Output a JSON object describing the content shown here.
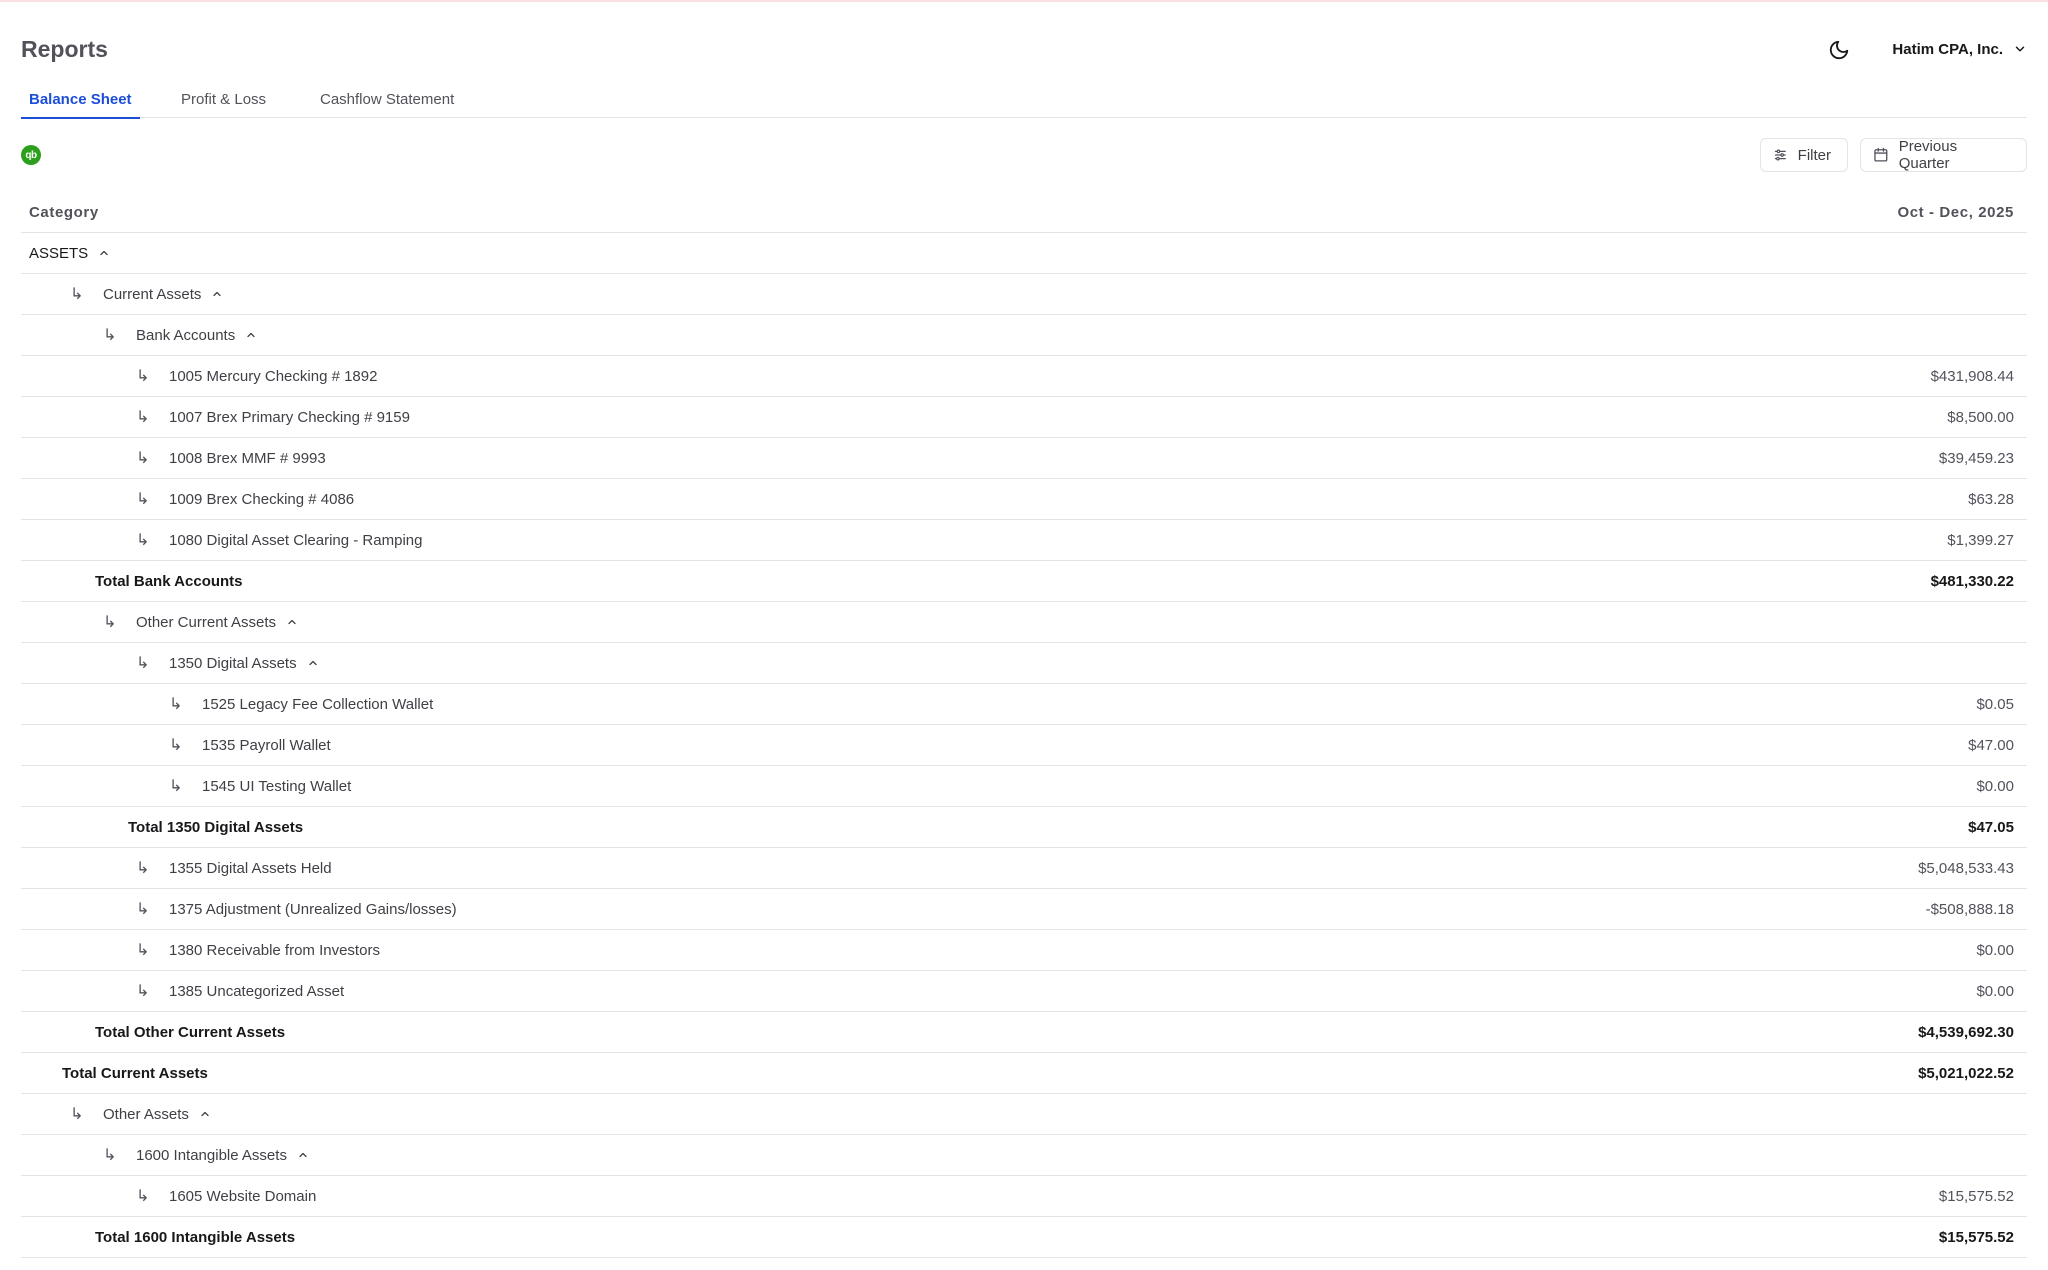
{
  "header": {
    "title": "Reports",
    "company": "Hatim CPA, Inc."
  },
  "tabs": [
    {
      "label": "Balance Sheet",
      "active": true
    },
    {
      "label": "Profit & Loss",
      "active": false
    },
    {
      "label": "Cashflow Statement",
      "active": false
    }
  ],
  "toolbar": {
    "logo_text": "qb",
    "filter_label": "Filter",
    "period_label": "Previous Quarter"
  },
  "table": {
    "col_category": "Category",
    "col_period": "Oct - Dec, 2025",
    "rows": [
      {
        "label": "ASSETS",
        "value": "",
        "level": 0,
        "kind": "section",
        "expandable": true
      },
      {
        "label": "Current Assets",
        "value": "",
        "level": 1,
        "kind": "group",
        "expandable": true
      },
      {
        "label": "Bank Accounts",
        "value": "",
        "level": 2,
        "kind": "group",
        "expandable": true
      },
      {
        "label": "1005 Mercury Checking # 1892",
        "value": "$431,908.44",
        "level": 3,
        "kind": "item"
      },
      {
        "label": "1007 Brex Primary Checking # 9159",
        "value": "$8,500.00",
        "level": 3,
        "kind": "item"
      },
      {
        "label": "1008 Brex MMF # 9993",
        "value": "$39,459.23",
        "level": 3,
        "kind": "item"
      },
      {
        "label": "1009 Brex Checking # 4086",
        "value": "$63.28",
        "level": 3,
        "kind": "item"
      },
      {
        "label": "1080 Digital Asset Clearing - Ramping",
        "value": "$1,399.27",
        "level": 3,
        "kind": "item"
      },
      {
        "label": "Total Bank Accounts",
        "value": "$481,330.22",
        "level": 2,
        "kind": "total"
      },
      {
        "label": "Other Current Assets",
        "value": "",
        "level": 2,
        "kind": "group",
        "expandable": true
      },
      {
        "label": "1350 Digital Assets",
        "value": "",
        "level": 3,
        "kind": "group",
        "expandable": true
      },
      {
        "label": "1525 Legacy Fee Collection Wallet",
        "value": "$0.05",
        "level": 4,
        "kind": "item"
      },
      {
        "label": "1535 Payroll Wallet",
        "value": "$47.00",
        "level": 4,
        "kind": "item"
      },
      {
        "label": "1545 UI Testing Wallet",
        "value": "$0.00",
        "level": 4,
        "kind": "item"
      },
      {
        "label": "Total 1350 Digital Assets",
        "value": "$47.05",
        "level": 3,
        "kind": "total"
      },
      {
        "label": "1355 Digital Assets Held",
        "value": "$5,048,533.43",
        "level": 3,
        "kind": "item"
      },
      {
        "label": "1375 Adjustment (Unrealized Gains/losses)",
        "value": "-$508,888.18",
        "level": 3,
        "kind": "item"
      },
      {
        "label": "1380 Receivable from Investors",
        "value": "$0.00",
        "level": 3,
        "kind": "item"
      },
      {
        "label": "1385 Uncategorized Asset",
        "value": "$0.00",
        "level": 3,
        "kind": "item"
      },
      {
        "label": "Total Other Current Assets",
        "value": "$4,539,692.30",
        "level": 2,
        "kind": "total"
      },
      {
        "label": "Total Current Assets",
        "value": "$5,021,022.52",
        "level": 1,
        "kind": "total"
      },
      {
        "label": "Other Assets",
        "value": "",
        "level": 1,
        "kind": "group",
        "expandable": true
      },
      {
        "label": "1600 Intangible Assets",
        "value": "",
        "level": 2,
        "kind": "group",
        "expandable": true
      },
      {
        "label": "1605 Website Domain",
        "value": "$15,575.52",
        "level": 3,
        "kind": "item"
      },
      {
        "label": "Total 1600 Intangible Assets",
        "value": "$15,575.52",
        "level": 2,
        "kind": "total"
      }
    ]
  }
}
